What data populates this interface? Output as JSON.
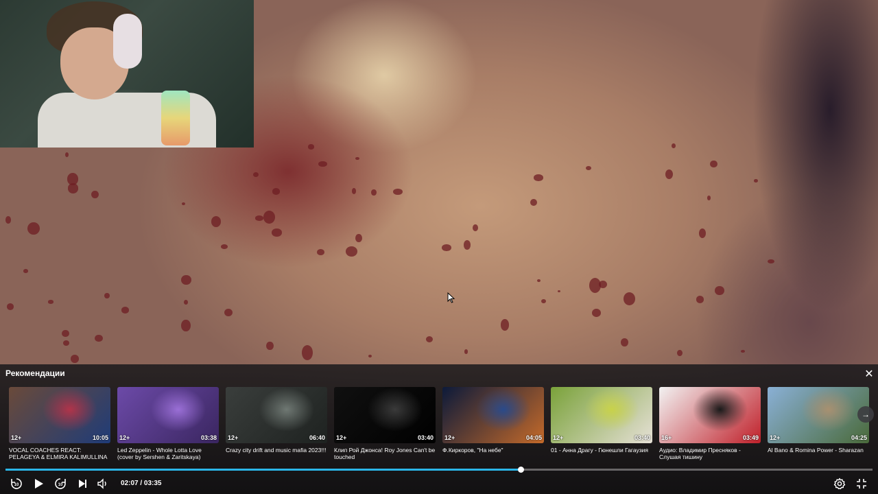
{
  "recommendations": {
    "title": "Рекомендации",
    "close_label": "✕",
    "next_label": "→",
    "cards": [
      {
        "title": "VOCAL COACHES REACT: PELAGEYA & ELMIRA KALIMULLINA - CANÇÃO DO...",
        "age": "12+",
        "duration": "10:05",
        "thumb_colors": [
          "#6a4a3a",
          "#b0344a",
          "#1f3c78"
        ]
      },
      {
        "title": "Led Zeppelin - Whole Lotta Love (cover by Sershen & Zaritskaya)",
        "age": "12+",
        "duration": "03:38",
        "thumb_colors": [
          "#6c4aa8",
          "#9a6fd6",
          "#3a2660"
        ]
      },
      {
        "title": "Crazy city drift and music mafia 2023!!!",
        "age": "12+",
        "duration": "06:40",
        "thumb_colors": [
          "#3a3e3c",
          "#6f7873",
          "#1e2220"
        ]
      },
      {
        "title": "Клип Рой Джонса! Roy Jones Can't be touched",
        "age": "12+",
        "duration": "03:40",
        "thumb_colors": [
          "#101010",
          "#3a3a3a",
          "#000000"
        ]
      },
      {
        "title": "Ф.Киркоров, \"На небе\"",
        "age": "12+",
        "duration": "04:05",
        "thumb_colors": [
          "#0c1a3a",
          "#2a4a8a",
          "#c46a2a"
        ]
      },
      {
        "title": "01 - Анна Драгу - Гюнешли Гагаузия",
        "age": "12+",
        "duration": "03:40",
        "thumb_colors": [
          "#7aa23a",
          "#c8d24a",
          "#e6e0d6"
        ]
      },
      {
        "title": "Аудио: Владимир Пресняков - Слушая тишину",
        "age": "16+",
        "duration": "03:49",
        "thumb_colors": [
          "#f2f2f2",
          "#1a1a1a",
          "#c0202a"
        ]
      },
      {
        "title": "Al Bano & Romina Power - Sharazan",
        "age": "12+",
        "duration": "04:25",
        "thumb_colors": [
          "#8ab0d6",
          "#a89070",
          "#4a6a3a"
        ]
      }
    ]
  },
  "player": {
    "progress": 0.594,
    "time_current": "02:07",
    "time_total": "03:35",
    "time_separator": " / ",
    "accent_color": "#2bb6e8",
    "icons": [
      "rewind-10-icon",
      "play-icon",
      "forward-10-icon",
      "next-icon",
      "volume-icon",
      "settings-icon",
      "fullscreen-icon"
    ]
  }
}
